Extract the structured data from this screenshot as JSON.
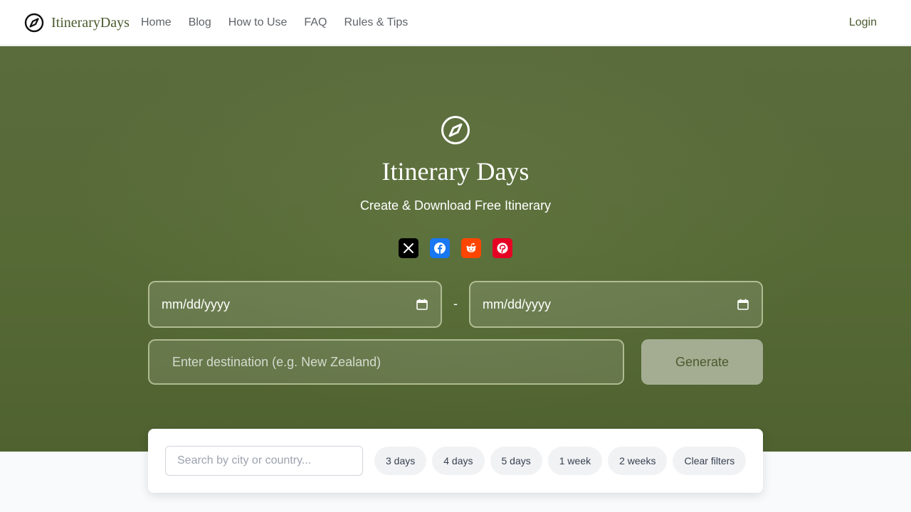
{
  "nav": {
    "brand": "ItineraryDays",
    "brand_icon": "compass-icon",
    "links": [
      "Home",
      "Blog",
      "How to Use",
      "FAQ",
      "Rules & Tips"
    ],
    "login": "Login"
  },
  "hero": {
    "icon": "compass-icon",
    "title": "Itinerary Days",
    "subtitle": "Create & Download Free Itinerary",
    "socials": [
      {
        "name": "x-icon",
        "color": "#000000"
      },
      {
        "name": "facebook-icon",
        "color": "#1877f2"
      },
      {
        "name": "reddit-icon",
        "color": "#ff4500"
      },
      {
        "name": "pinterest-icon",
        "color": "#e60023"
      }
    ],
    "start_date_placeholder": "mm/dd/yyyy",
    "end_date_placeholder": "mm/dd/yyyy",
    "date_separator": "-",
    "destination_placeholder": "Enter destination (e.g. New Zealand)",
    "generate_label": "Generate"
  },
  "filters": {
    "search_placeholder": "Search by city or country...",
    "chips": [
      "3 days",
      "4 days",
      "5 days",
      "1 week",
      "2 weeks",
      "Clear filters"
    ]
  },
  "colors": {
    "brand": "#4b5a2e",
    "hero_bg": "#566a36",
    "generate_bg": "#a4ad92"
  }
}
